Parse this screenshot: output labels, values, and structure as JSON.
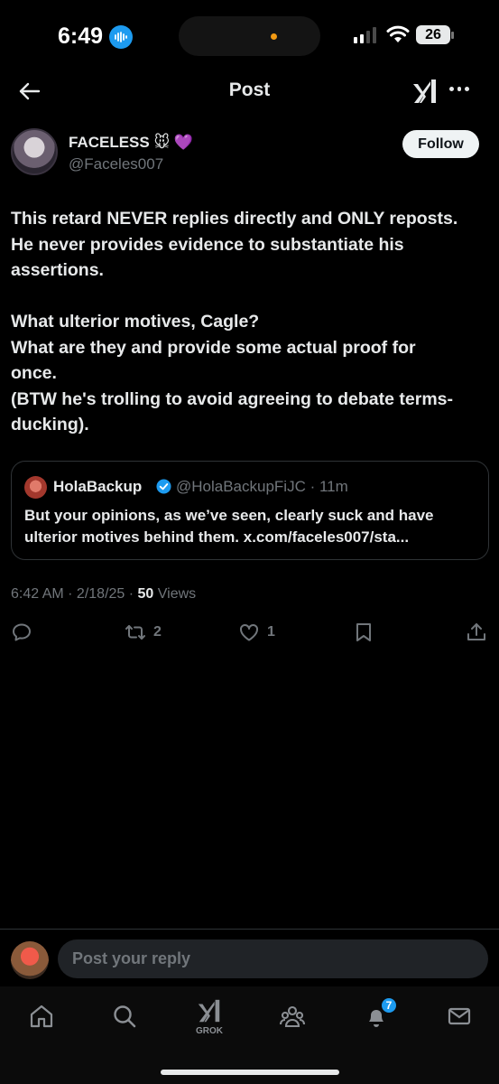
{
  "status_bar": {
    "time": "6:49",
    "battery": "26"
  },
  "header": {
    "title": "Post"
  },
  "author": {
    "display_name": "FACELESS 🐭 💜",
    "handle": "@Faceles007"
  },
  "follow_label": "Follow",
  "post": {
    "paragraphs": [
      [
        "This retard NEVER replies directly and ONLY reposts.",
        "He never provides evidence to substantiate his",
        "assertions."
      ],
      [
        "What ulterior motives, Cagle?",
        "What are they and provide some actual proof for",
        "once.",
        "(BTW he's trolling to avoid agreeing to debate terms-",
        "ducking)."
      ]
    ]
  },
  "quote": {
    "name": "HolaBackup",
    "handle_time": "@HolaBackupFiJC · 11m",
    "lines": [
      "But your opinions, as we’ve seen, clearly suck and have",
      "ulterior motives behind them. x.com/faceles007/sta..."
    ]
  },
  "meta": {
    "timestamp": "6:42 AM · 2/18/25 · ",
    "views_count": "50",
    "views_label": " Views"
  },
  "actions": {
    "reposts": "2",
    "likes": "1"
  },
  "reply": {
    "placeholder": "Post your reply"
  },
  "tabbar": {
    "grok_label": "GROK",
    "notifications_badge": "7"
  },
  "colors": {
    "accent": "#1d9bf0",
    "background": "#000000",
    "text": "#e7e9ea",
    "muted": "#71767b"
  },
  "icons": [
    "back-arrow-icon",
    "grok-icon",
    "more-icon",
    "verified-icon",
    "reply-icon",
    "repost-icon",
    "like-icon",
    "bookmark-icon",
    "share-icon",
    "home-icon",
    "search-icon",
    "communities-icon",
    "bell-icon",
    "mail-icon"
  ]
}
